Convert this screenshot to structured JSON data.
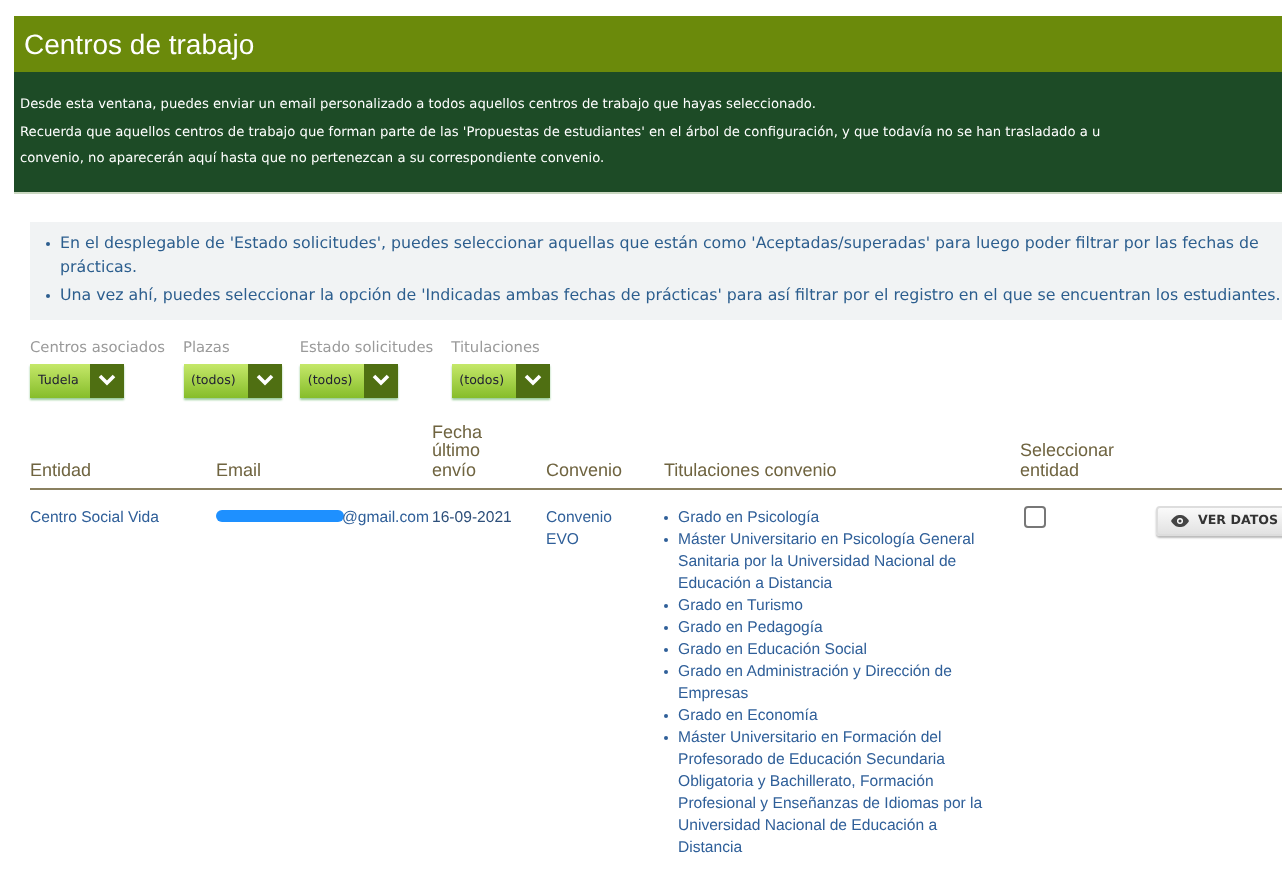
{
  "header": {
    "title": "Centros de trabajo"
  },
  "notice": {
    "lines": [
      "Desde esta ventana, puedes enviar un email personalizado a todos aquellos centros de trabajo que hayas seleccionado.",
      "Recuerda que aquellos centros de trabajo que forman parte de las 'Propuestas de estudiantes' en el árbol de configuración, y que todavía no se han trasladado a u",
      "convenio, no aparecerán aquí hasta que no pertenezcan a su correspondiente convenio."
    ]
  },
  "tips": [
    "En el desplegable de 'Estado solicitudes', puedes seleccionar aquellas que están como 'Aceptadas/superadas' para luego poder filtrar por las fechas de prácticas.",
    "Una vez ahí, puedes seleccionar la opción de 'Indicadas ambas fechas de prácticas' para así filtrar por el registro en el que se encuentran los estudiantes."
  ],
  "filters": [
    {
      "label": "Centros asociados",
      "value": "Tudela"
    },
    {
      "label": "Plazas",
      "value": "(todos)"
    },
    {
      "label": "Estado solicitudes",
      "value": "(todos)"
    },
    {
      "label": "Titulaciones",
      "value": "(todos)"
    }
  ],
  "table": {
    "columns": [
      "Entidad",
      "Email",
      "Fecha último envío",
      "Convenio",
      "Titulaciones convenio",
      "Seleccionar entidad"
    ],
    "rows": [
      {
        "entidad": "Centro Social Vida",
        "email": "@gmail.com",
        "email_redacted": true,
        "fecha": "16-09-2021",
        "convenio": "Convenio EVO",
        "selected": false,
        "action": "VER DATOS",
        "titulaciones": [
          "Grado en Psicología",
          "Máster Universitario en Psicología General Sanitaria por la Universidad Nacional de Educación a Distancia",
          "Grado en Turismo",
          "Grado en Pedagogía",
          "Grado en Educación Social",
          "Grado en Administración y Dirección de Empresas",
          "Grado en Economía",
          "Máster Universitario en Formación del Profesorado de Educación Secundaria Obligatoria y Bachillerato, Formación Profesional y Enseñanzas de Idiomas por la Universidad Nacional de Educación a Distancia"
        ]
      }
    ]
  }
}
